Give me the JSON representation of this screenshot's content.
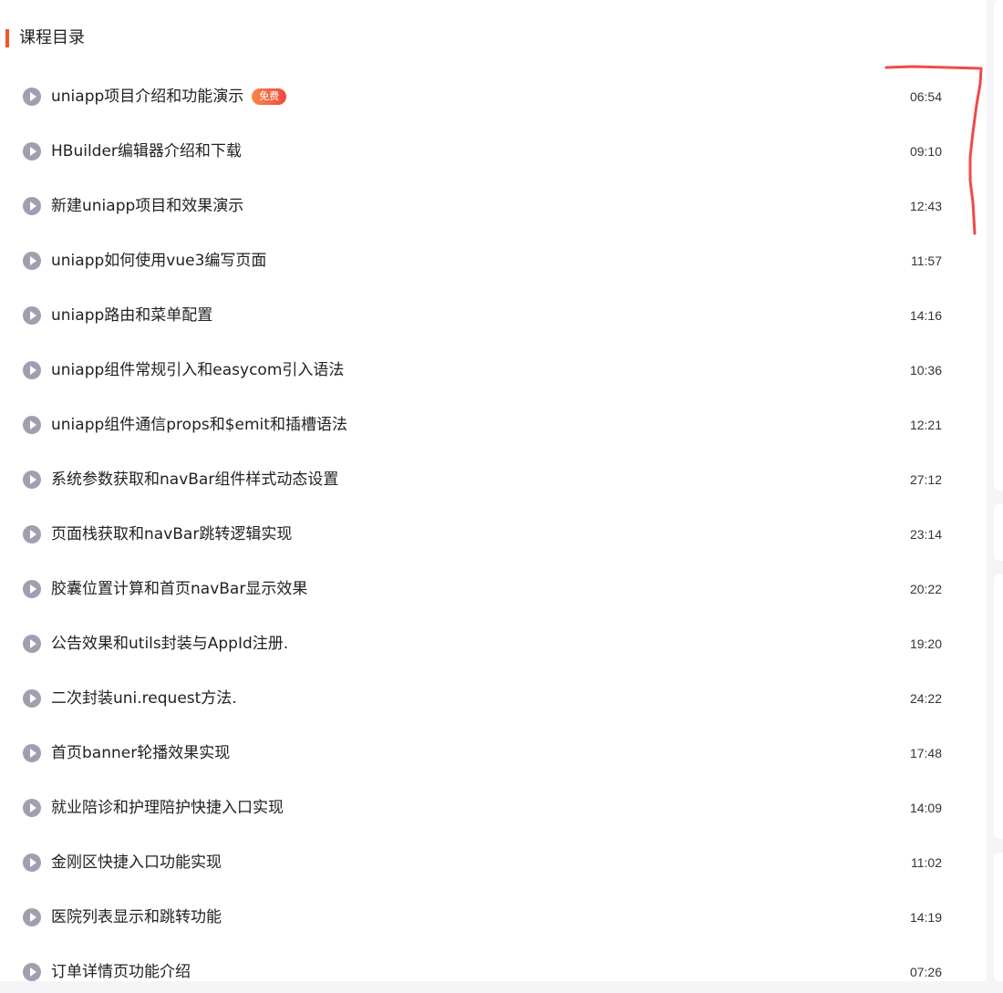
{
  "section": {
    "title": "课程目录"
  },
  "lessons": [
    {
      "title": "uniapp项目介绍和功能演示",
      "badge": "免费",
      "duration": "06:54"
    },
    {
      "title": "HBuilder编辑器介绍和下载",
      "duration": "09:10"
    },
    {
      "title": "新建uniapp项目和效果演示",
      "duration": "12:43"
    },
    {
      "title": "uniapp如何使用vue3编写页面",
      "duration": "11:57"
    },
    {
      "title": "uniapp路由和菜单配置",
      "duration": "14:16"
    },
    {
      "title": "uniapp组件常规引入和easycom引入语法",
      "duration": "10:36"
    },
    {
      "title": "uniapp组件通信props和$emit和插槽语法",
      "duration": "12:21"
    },
    {
      "title": "系统参数获取和navBar组件样式动态设置",
      "duration": "27:12"
    },
    {
      "title": "页面栈获取和navBar跳转逻辑实现",
      "duration": "23:14"
    },
    {
      "title": "胶囊位置计算和首页navBar显示效果",
      "duration": "20:22"
    },
    {
      "title": "公告效果和utils封装与AppId注册.",
      "duration": "19:20"
    },
    {
      "title": "二次封装uni.request方法.",
      "duration": "24:22"
    },
    {
      "title": "首页banner轮播效果实现",
      "duration": "17:48"
    },
    {
      "title": "就业陪诊和护理陪护快捷入口实现",
      "duration": "14:09"
    },
    {
      "title": "金刚区快捷入口功能实现",
      "duration": "11:02"
    },
    {
      "title": "医院列表显示和跳转功能",
      "duration": "14:19"
    },
    {
      "title": "订单详情页功能介绍",
      "duration": "07:26"
    }
  ],
  "colors": {
    "accent": "#f0542d",
    "play_icon": "#9ea0b0",
    "annotation": "#f04a4a"
  },
  "icons": {
    "play": "play-circle-icon"
  }
}
